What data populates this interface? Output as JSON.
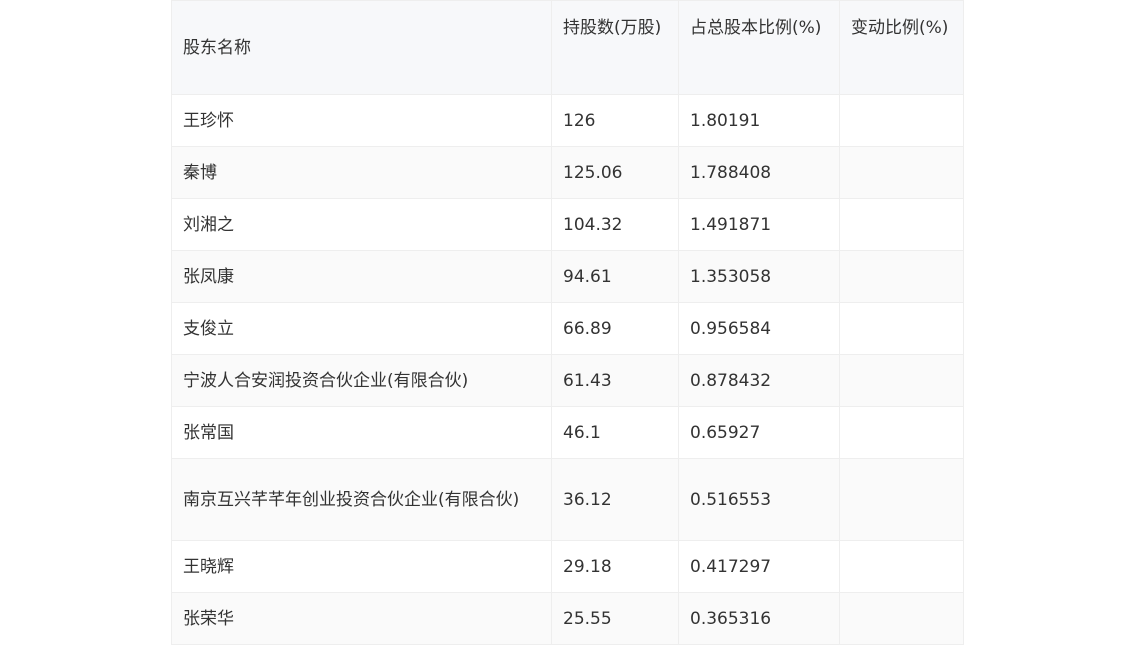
{
  "table": {
    "headers": [
      "股东名称",
      "持股数(万股)",
      "占总股本比例(%)",
      "变动比例(%)"
    ],
    "rows": [
      [
        "王珍怀",
        "126",
        "1.80191",
        ""
      ],
      [
        "秦博",
        "125.06",
        "1.788408",
        ""
      ],
      [
        "刘湘之",
        "104.32",
        "1.491871",
        ""
      ],
      [
        "张凤康",
        "94.61",
        "1.353058",
        ""
      ],
      [
        "支俊立",
        "66.89",
        "0.956584",
        ""
      ],
      [
        "宁波人合安润投资合伙企业(有限合伙)",
        "61.43",
        "0.878432",
        ""
      ],
      [
        "张常国",
        "46.1",
        "0.65927",
        ""
      ],
      [
        "南京互兴芊芊年创业投资合伙企业(有限合伙)",
        "36.12",
        "0.516553",
        ""
      ],
      [
        "王晓辉",
        "29.18",
        "0.417297",
        ""
      ],
      [
        "张荣华",
        "25.55",
        "0.365316",
        ""
      ]
    ]
  }
}
